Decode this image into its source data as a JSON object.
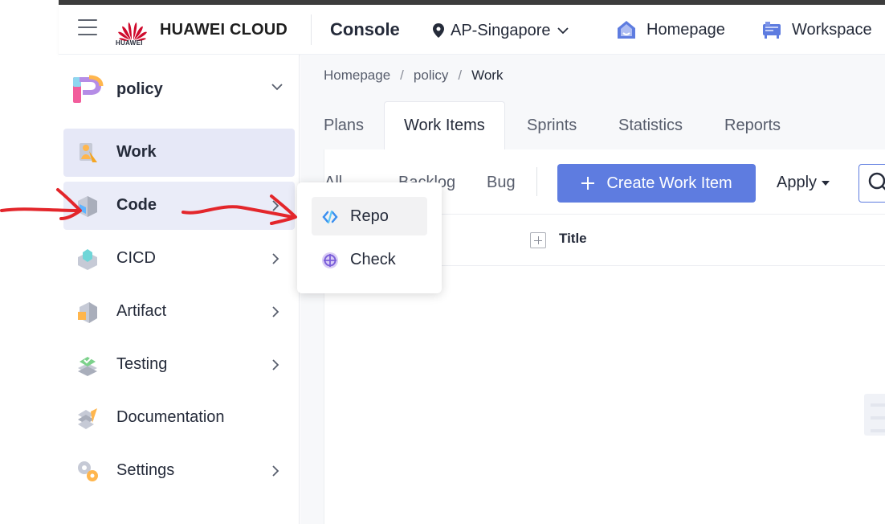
{
  "header": {
    "brand_sub": "HUAWEI",
    "brand": "HUAWEI CLOUD",
    "console": "Console",
    "region": "AP-Singapore",
    "homepage": "Homepage",
    "workspace": "Workspace"
  },
  "sidebar": {
    "project": "policy",
    "items": [
      {
        "label": "Work"
      },
      {
        "label": "Code"
      },
      {
        "label": "CICD"
      },
      {
        "label": "Artifact"
      },
      {
        "label": "Testing"
      },
      {
        "label": "Documentation"
      },
      {
        "label": "Settings"
      }
    ]
  },
  "breadcrumb": [
    "Homepage",
    "policy",
    "Work"
  ],
  "tabs": [
    "Plans",
    "Work Items",
    "Sprints",
    "Statistics",
    "Reports"
  ],
  "toolbar": {
    "filters": [
      "All",
      "Backlog",
      "Bug"
    ],
    "create_label": "Create Work Item",
    "apply_label": "Apply"
  },
  "table": {
    "title_header": "Title"
  },
  "code_menu": {
    "items": [
      {
        "label": "Repo"
      },
      {
        "label": "Check"
      }
    ]
  },
  "colors": {
    "primary": "#5e7ce0",
    "active_bg": "#e6e8f7",
    "annotation": "#e3262b"
  }
}
